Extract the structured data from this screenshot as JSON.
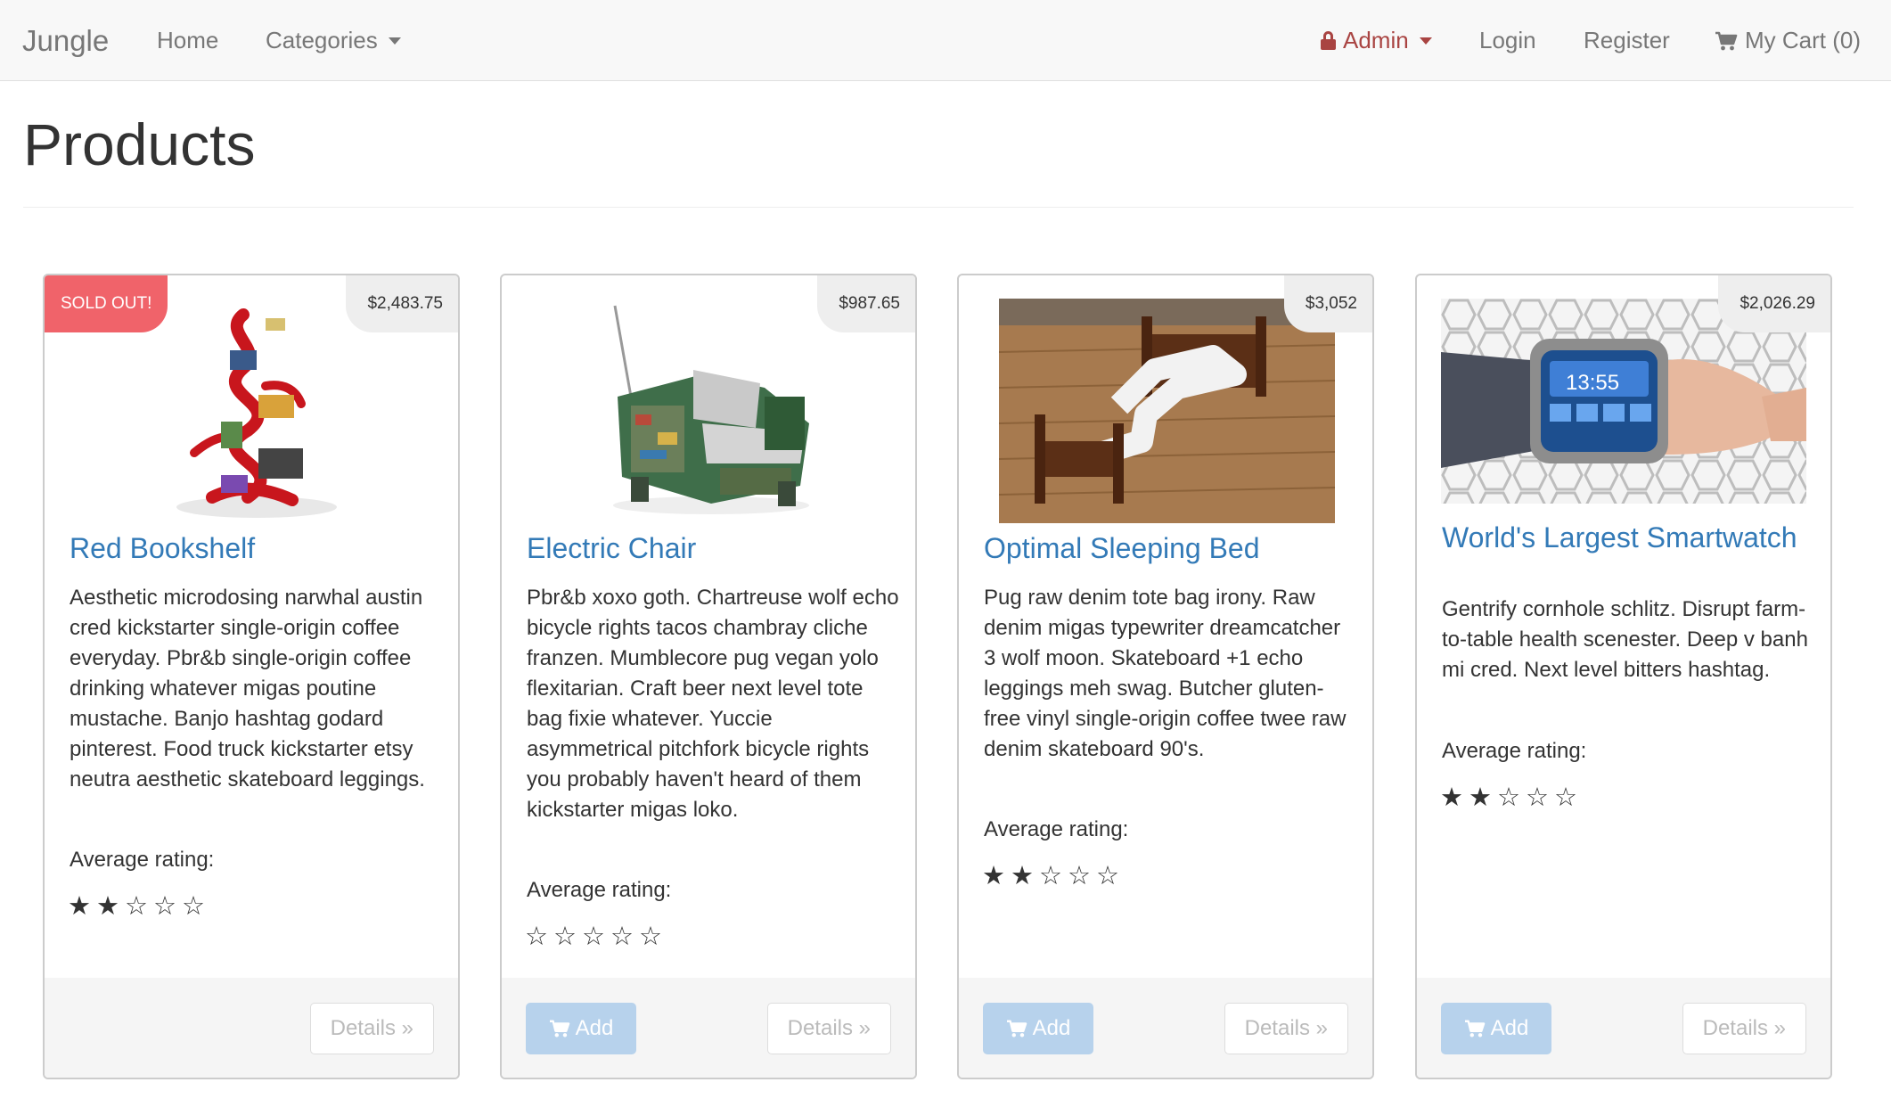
{
  "navbar": {
    "brand": "Jungle",
    "home": "Home",
    "categories": "Categories",
    "admin": "Admin",
    "login": "Login",
    "register": "Register",
    "cart": "My Cart (0)"
  },
  "page": {
    "title": "Products"
  },
  "products": [
    {
      "name": "Red Bookshelf",
      "price": "$2,483.75",
      "badge": "SOLD OUT!",
      "description": "Aesthetic microdosing narwhal austin cred kickstarter single-origin coffee everyday. Pbr&b single-origin coffee drinking whatever migas poutine mustache. Banjo hashtag godard pinterest. Food truck kickstarter etsy neutra aesthetic skateboard leggings.",
      "rating_label": "Average rating:",
      "stars": "★★☆☆☆",
      "rating": 2,
      "details_label": "Details »"
    },
    {
      "name": "Electric Chair",
      "price": "$987.65",
      "description": "Pbr&b xoxo goth. Chartreuse wolf echo bicycle rights tacos chambray cliche franzen. Mumblecore pug vegan yolo flexitarian. Craft beer next level tote bag fixie whatever. Yuccie asymmetrical pitchfork bicycle rights you probably haven't heard of them kickstarter migas loko.",
      "rating_label": "Average rating:",
      "stars": "☆☆☆☆☆",
      "rating": 0,
      "add_label": "Add",
      "details_label": "Details »"
    },
    {
      "name": "Optimal Sleeping Bed",
      "price": "$3,052",
      "description": "Pug raw denim tote bag irony. Raw denim migas typewriter dreamcatcher 3 wolf moon. Skateboard +1 echo leggings meh swag. Butcher gluten-free vinyl single-origin coffee twee raw denim skateboard 90's.",
      "rating_label": "Average rating:",
      "stars": "★★☆☆☆",
      "rating": 2,
      "add_label": "Add",
      "details_label": "Details »"
    },
    {
      "name": "World's Largest Smartwatch",
      "price": "$2,026.29",
      "watch_time": "13:55",
      "description": "Gentrify cornhole schlitz. Disrupt farm-to-table health scenester. Deep v banh mi cred. Next level bitters hashtag.",
      "rating_label": "Average rating:",
      "stars": "★★☆☆☆",
      "rating": 2,
      "add_label": "Add",
      "details_label": "Details »"
    }
  ],
  "colors": {
    "link": "#337ab7",
    "admin": "#a94442",
    "sold_out": "#f0636a",
    "add_button": "#b7d2ec"
  }
}
